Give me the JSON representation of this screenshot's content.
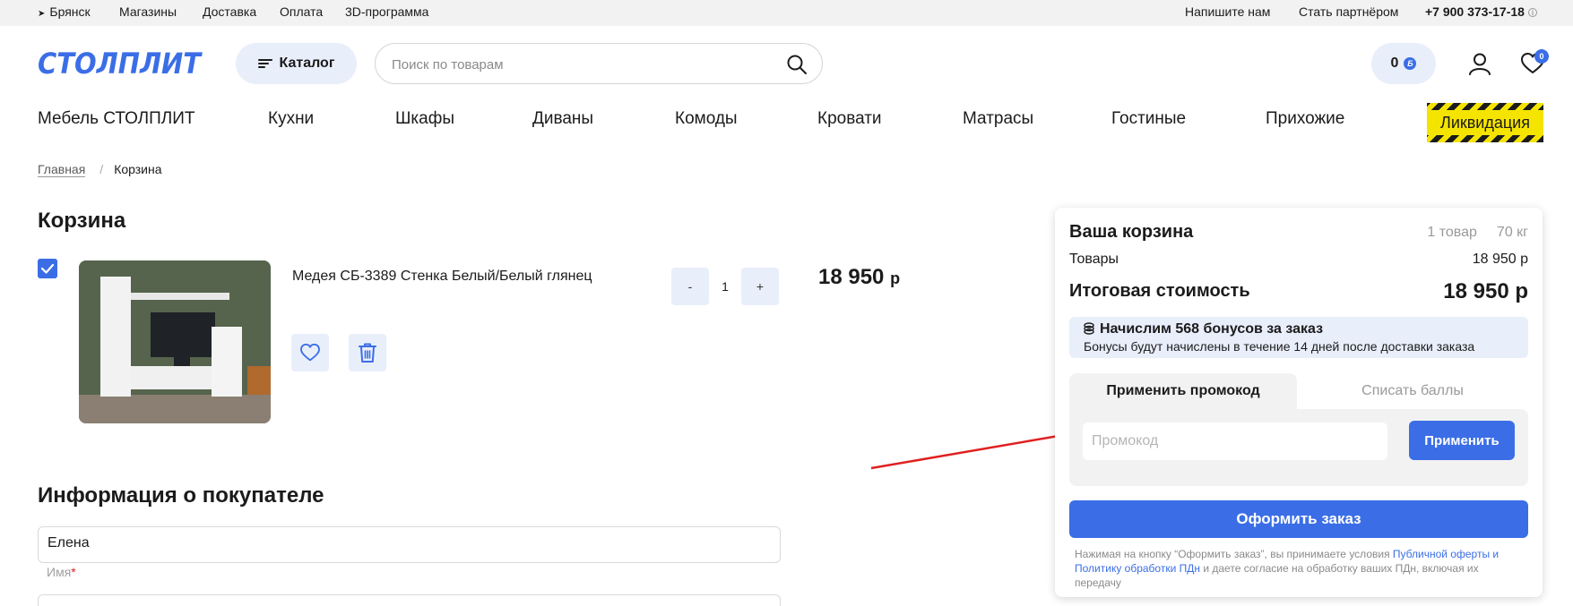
{
  "topbar": {
    "city": "Брянск",
    "links": [
      "Магазины",
      "Доставка",
      "Оплата",
      "3D-программа"
    ],
    "write_us": "Напишите нам",
    "partner": "Стать партнёром",
    "phone": "+7 900 373-17-18"
  },
  "header": {
    "logo_text": "СТОЛПЛИТ",
    "catalog_label": "Каталог",
    "search_placeholder": "Поиск по товарам",
    "bonus_count": "0",
    "bonus_badge": "Б",
    "favorites_count": "0"
  },
  "nav": {
    "items": [
      "Мебель СТОЛПЛИТ",
      "Кухни",
      "Шкафы",
      "Диваны",
      "Комоды",
      "Кровати",
      "Матрасы",
      "Гостиные",
      "Прихожие"
    ],
    "liquidation": "Ликвидация"
  },
  "breadcrumb": {
    "home": "Главная",
    "separator": "/",
    "current": "Корзина"
  },
  "cart": {
    "title": "Корзина",
    "item": {
      "name": "Медея СБ-3389 Стенка Белый/Белый глянец",
      "quantity": "1",
      "minus": "-",
      "plus": "+",
      "price": "18 950",
      "currency": "р"
    }
  },
  "buyer": {
    "title": "Информация о покупателе",
    "name_value": "Елена",
    "name_label": "Имя",
    "required_mark": "*"
  },
  "summary": {
    "title": "Ваша корзина",
    "items_count": "1 товар",
    "weight": "70 кг",
    "goods_label": "Товары",
    "goods_value": "18 950 р",
    "total_label": "Итоговая стоимость",
    "total_value": "18 950 р",
    "bonus_title": "Начислим 568 бонусов за заказ",
    "bonus_sub": "Бонусы будут начислены в течение 14 дней после доставки заказа",
    "tab_promo": "Применить промокод",
    "tab_points": "Списать баллы",
    "promo_placeholder": "Промокод",
    "apply_label": "Применить",
    "order_label": "Оформить заказ",
    "legal_prefix": "Нажимая на кнопку “Оформить заказ”, вы принимаете условия",
    "legal_link": "Публичной оферты и Политику обработки ПДн",
    "legal_suffix": "и даете согласие на обработку ваших ПДн, включая их передачу"
  },
  "colors": {
    "accent": "#3b6ee6",
    "light_accent": "#e9eefb",
    "arrow": "#e02020",
    "liquidation_yellow": "#f4e400"
  }
}
